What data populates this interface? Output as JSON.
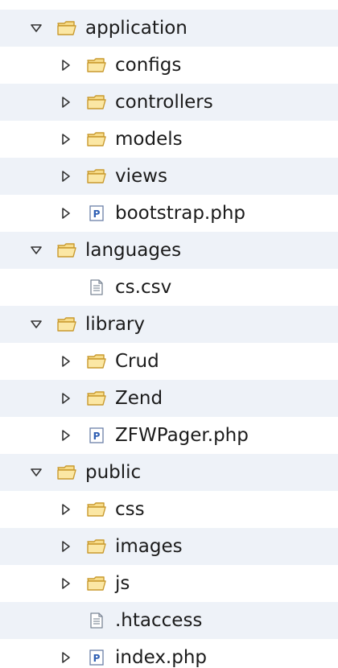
{
  "tree": {
    "rows": [
      {
        "label": "application",
        "type": "folder",
        "expander": "expanded",
        "level": 0,
        "stripe": true
      },
      {
        "label": "configs",
        "type": "folder",
        "expander": "collapsed",
        "level": 1,
        "stripe": false
      },
      {
        "label": "controllers",
        "type": "folder",
        "expander": "collapsed",
        "level": 1,
        "stripe": true
      },
      {
        "label": "models",
        "type": "folder",
        "expander": "collapsed",
        "level": 1,
        "stripe": false
      },
      {
        "label": "views",
        "type": "folder",
        "expander": "collapsed",
        "level": 1,
        "stripe": true
      },
      {
        "label": "bootstrap.php",
        "type": "php-file",
        "expander": "collapsed",
        "level": 1,
        "stripe": false
      },
      {
        "label": "languages",
        "type": "folder",
        "expander": "expanded",
        "level": 0,
        "stripe": true
      },
      {
        "label": "cs.csv",
        "type": "text-file",
        "expander": "none",
        "level": 1,
        "stripe": false
      },
      {
        "label": "library",
        "type": "folder",
        "expander": "expanded",
        "level": 0,
        "stripe": true
      },
      {
        "label": "Crud",
        "type": "folder",
        "expander": "collapsed",
        "level": 1,
        "stripe": false
      },
      {
        "label": "Zend",
        "type": "folder",
        "expander": "collapsed",
        "level": 1,
        "stripe": true
      },
      {
        "label": "ZFWPager.php",
        "type": "php-file",
        "expander": "collapsed",
        "level": 1,
        "stripe": false
      },
      {
        "label": "public",
        "type": "folder",
        "expander": "expanded",
        "level": 0,
        "stripe": true
      },
      {
        "label": "css",
        "type": "folder",
        "expander": "collapsed",
        "level": 1,
        "stripe": false
      },
      {
        "label": "images",
        "type": "folder",
        "expander": "collapsed",
        "level": 1,
        "stripe": true
      },
      {
        "label": "js",
        "type": "folder",
        "expander": "collapsed",
        "level": 1,
        "stripe": false
      },
      {
        "label": ".htaccess",
        "type": "text-file",
        "expander": "none",
        "level": 1,
        "stripe": true
      },
      {
        "label": "index.php",
        "type": "php-file",
        "expander": "collapsed",
        "level": 1,
        "stripe": false
      }
    ],
    "icons": {
      "folder": "folder-icon",
      "php-file": "php-file-icon",
      "text-file": "text-file-icon",
      "expanded": "expanded-arrow-icon",
      "collapsed": "collapsed-arrow-icon"
    },
    "colors": {
      "stripe": "#eef2f8",
      "folder_fill": "#fbe7a4",
      "folder_stroke": "#c99a2e",
      "php_badge": "#2f5fb3",
      "text": "#1b1b1b"
    }
  }
}
